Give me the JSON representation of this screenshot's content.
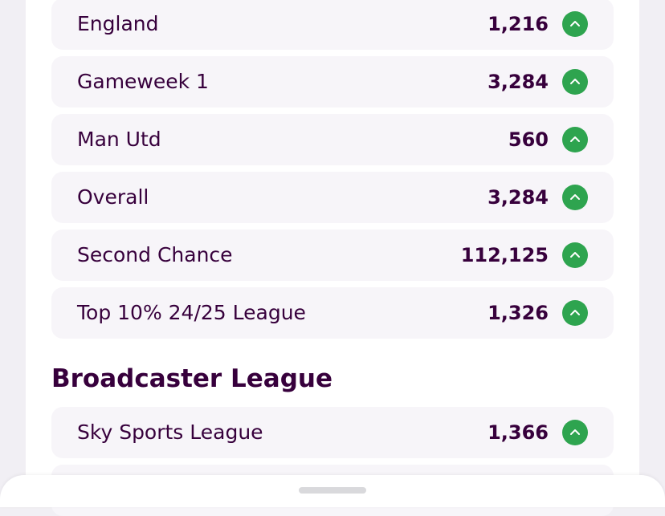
{
  "rows": [
    {
      "label": "England",
      "value": "1,216",
      "icon": "chevron-up-icon"
    },
    {
      "label": "Gameweek 1",
      "value": "3,284",
      "icon": "chevron-up-icon"
    },
    {
      "label": "Man Utd",
      "value": "560",
      "icon": "chevron-up-icon"
    },
    {
      "label": "Overall",
      "value": "3,284",
      "icon": "chevron-up-icon"
    },
    {
      "label": "Second Chance",
      "value": "112,125",
      "icon": "chevron-up-icon"
    },
    {
      "label": "Top 10% 24/25 League",
      "value": "1,326",
      "icon": "chevron-up-icon"
    }
  ],
  "broadcaster": {
    "title": "Broadcaster League",
    "rows": [
      {
        "label": "Sky Sports League",
        "value": "1,366",
        "icon": "chevron-up-icon"
      }
    ]
  },
  "colors": {
    "brand_purple": "#37003c",
    "rank_up_green": "#2ea44f",
    "row_background": "#f7f5f9"
  }
}
